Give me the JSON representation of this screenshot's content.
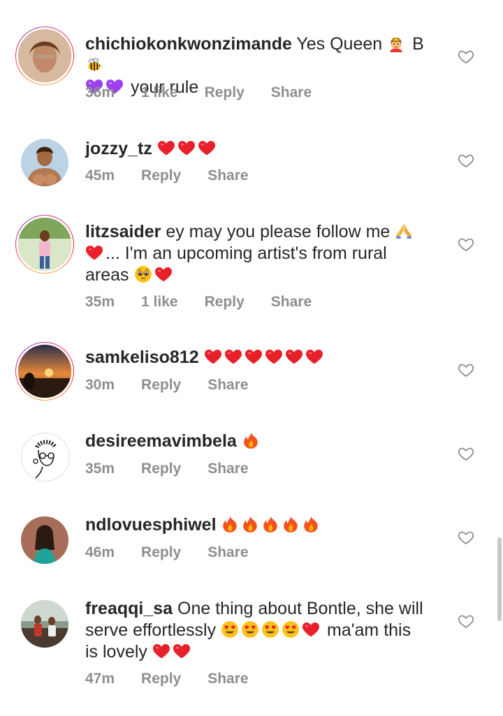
{
  "comments": [
    {
      "username": "chichiokonkwonzimande",
      "text_a": "Yes Queen",
      "text_b": "B",
      "text_c": "your rule",
      "time": "36m",
      "likes": "1 like",
      "reply": "Reply",
      "share": "Share",
      "emojis": [
        "queen-emoji",
        "bee-emoji",
        "purple-heart-emoji",
        "purple-heart-emoji"
      ]
    },
    {
      "username": "jozzy_tz",
      "text": "",
      "time": "45m",
      "reply": "Reply",
      "share": "Share",
      "emojis": [
        "red-heart-emoji",
        "red-heart-emoji",
        "red-heart-emoji"
      ]
    },
    {
      "username": "litzsaider",
      "text_a": "ey may you please follow me",
      "text_b": "... I'm an upcoming artist's from rural",
      "text_c": "areas",
      "time": "35m",
      "likes": "1 like",
      "reply": "Reply",
      "share": "Share",
      "emojis": [
        "folded-hands-emoji",
        "red-heart-emoji",
        "pleading-face-emoji",
        "red-heart-emoji"
      ]
    },
    {
      "username": "samkeliso812",
      "time": "30m",
      "reply": "Reply",
      "share": "Share",
      "emojis": [
        "red-heart-emoji",
        "red-heart-emoji",
        "red-heart-emoji",
        "red-heart-emoji",
        "red-heart-emoji",
        "red-heart-emoji"
      ]
    },
    {
      "username": "desireemavimbela",
      "time": "35m",
      "reply": "Reply",
      "share": "Share",
      "emojis": [
        "fire-emoji"
      ]
    },
    {
      "username": "ndlovuesphiwel",
      "time": "46m",
      "reply": "Reply",
      "share": "Share",
      "emojis": [
        "fire-emoji",
        "fire-emoji",
        "fire-emoji",
        "fire-emoji",
        "fire-emoji"
      ]
    },
    {
      "username": "freaqqi_sa",
      "text_a": "One thing about Bontle,  she will",
      "text_b": "serve effortlessly",
      "text_c": "ma'am this",
      "text_d": "is lovely",
      "time": "47m",
      "reply": "Reply",
      "share": "Share",
      "emojis": [
        "heart-eyes-emoji",
        "heart-eyes-emoji",
        "heart-eyes-emoji",
        "heart-eyes-emoji",
        "red-heart-emoji",
        "red-heart-emoji",
        "red-heart-emoji"
      ]
    }
  ],
  "colors": {
    "text": "#262626",
    "meta": "#8e8e8e",
    "heart": "#ed4956",
    "purple_heart": "#9b3ff0",
    "ring": "#e1306c"
  }
}
